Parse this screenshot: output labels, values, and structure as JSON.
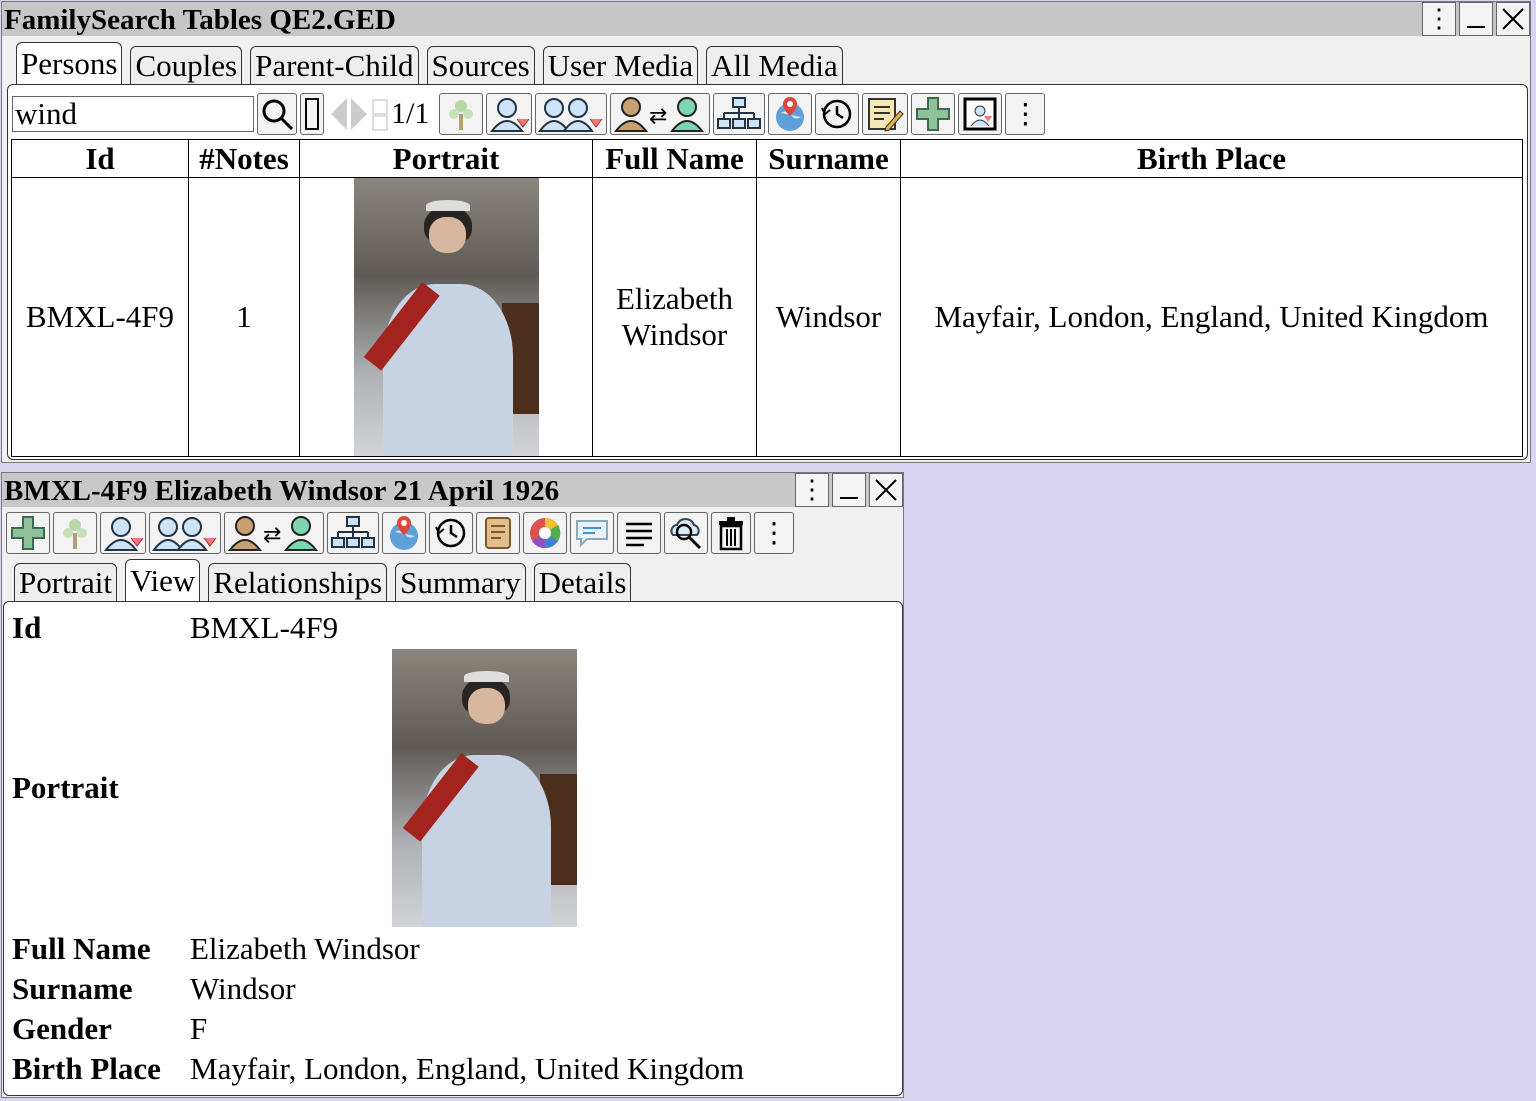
{
  "top_window": {
    "title": "FamilySearch Tables QE2.GED",
    "tabs": [
      {
        "label": "Persons",
        "active": true
      },
      {
        "label": "Couples"
      },
      {
        "label": "Parent-Child"
      },
      {
        "label": "Sources"
      },
      {
        "label": "User Media"
      },
      {
        "label": "All Media"
      }
    ],
    "search": {
      "value": "wind",
      "page": "1/1"
    },
    "table": {
      "headers": [
        "Id",
        "#Notes",
        "Portrait",
        "Full Name",
        "Surname",
        "Birth Place"
      ],
      "rows": [
        {
          "id": "BMXL-4F9",
          "notes": "1",
          "full_name_1": "Elizabeth",
          "full_name_2": "Windsor",
          "surname": "Windsor",
          "birth_place": "Mayfair, London, England, United Kingdom"
        }
      ]
    }
  },
  "detail_window": {
    "title": "BMXL-4F9 Elizabeth Windsor 21 April 1926",
    "tabs": [
      {
        "label": "Portrait"
      },
      {
        "label": "View",
        "active": true
      },
      {
        "label": "Relationships"
      },
      {
        "label": "Summary"
      },
      {
        "label": "Details"
      }
    ],
    "fields": {
      "id_label": "Id",
      "id_value": "BMXL-4F9",
      "portrait_label": "Portrait",
      "full_name_label": "Full Name",
      "full_name_value": "Elizabeth Windsor",
      "surname_label": "Surname",
      "surname_value": "Windsor",
      "gender_label": "Gender",
      "gender_value": "F",
      "birth_place_label": "Birth Place",
      "birth_place_value": "Mayfair, London, England, United Kingdom"
    }
  },
  "colors": {
    "desktop": "#d8d4f2",
    "titlebar": "#c6c6c6",
    "sash": "#a3241e"
  }
}
